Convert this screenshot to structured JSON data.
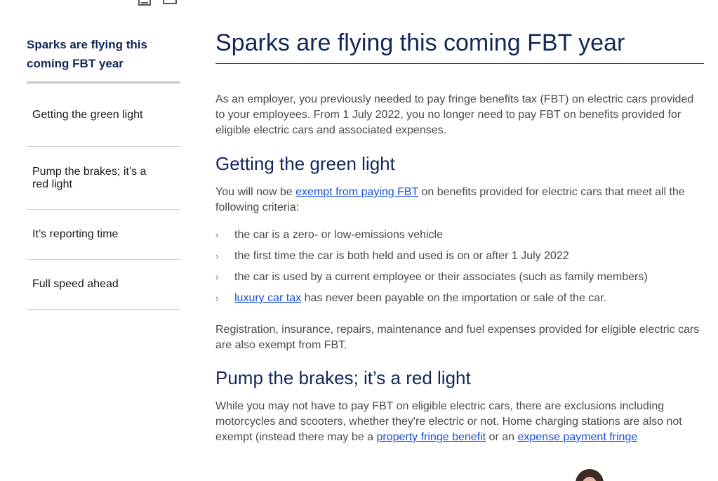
{
  "toolbar": {
    "icons": [
      "document-icon",
      "print-icon"
    ]
  },
  "sidebar": {
    "title": "Sparks are flying this coming FBT year",
    "items": [
      {
        "label": "Getting the green light"
      },
      {
        "label": "Pump the brakes; it’s a red light"
      },
      {
        "label": "It’s reporting time"
      },
      {
        "label": "Full speed ahead"
      }
    ]
  },
  "main": {
    "title": "Sparks are flying this coming FBT year",
    "intro": "As an employer, you previously needed to pay fringe benefits tax (FBT) on electric cars provided to your employees. From 1 July 2022, you no longer need to pay FBT on benefits provided for eligible electric cars and associated expenses.",
    "section1": {
      "heading": "Getting the green light",
      "p1_before": "You will now be ",
      "p1_link": "exempt from paying FBT",
      "p1_after": " on benefits provided for electric cars that meet all the following criteria:",
      "criteria": [
        {
          "text": "the car is a zero- or low-emissions vehicle"
        },
        {
          "text": "the first time the car is both held and used is on or after 1 July 2022"
        },
        {
          "text": "the car is used by a current employee or their associates (such as family members)"
        }
      ],
      "criteria_last_link": "luxury car tax",
      "criteria_last_after": " has never been payable on the importation or sale of the car.",
      "p2": "Registration, insurance, repairs, maintenance and fuel expenses provided for eligible electric cars are also exempt from FBT."
    },
    "section2": {
      "heading": "Pump the brakes; it’s a red light",
      "p1_before": "While you may not have to pay FBT on eligible electric cars, there are exclusions including motorcycles and scooters, whether they're electric or not. Home charging stations are also not exempt (instead there may be a ",
      "p1_link1": "property fringe benefit",
      "p1_mid": " or an ",
      "p1_link2": "expense payment fringe"
    }
  },
  "chevron": "›",
  "colors": {
    "heading": "#12285a",
    "link": "#1a4fd6",
    "body_text": "#4a4a4a"
  }
}
